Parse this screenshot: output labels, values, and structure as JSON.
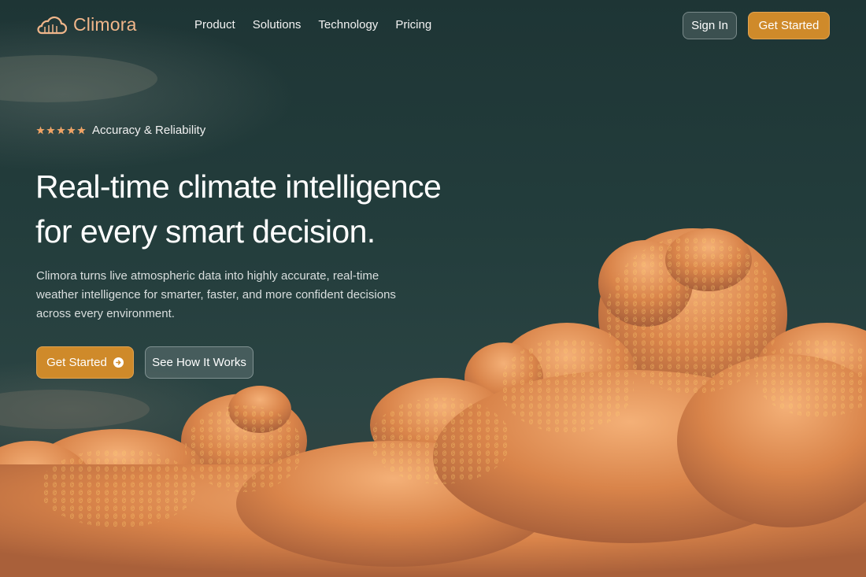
{
  "brand": {
    "name": "Climora",
    "logo_icon": "cloud-icon"
  },
  "nav": {
    "links": [
      "Product",
      "Solutions",
      "Technology",
      "Pricing"
    ],
    "sign_in": "Sign In",
    "get_started": "Get Started"
  },
  "hero": {
    "rating": {
      "stars": 5,
      "label": "Accuracy & Reliability"
    },
    "headline": [
      "Real-time climate intelligence",
      "for every smart decision."
    ],
    "description": "Climora turns live atmospheric data into highly accurate, real-time weather intelligence for smarter, faster, and more confident decisions across every environment.",
    "primary_cta": "Get Started",
    "primary_cta_icon": "arrow-right-circle-icon",
    "secondary_cta": "See How It Works"
  },
  "colors": {
    "accent": "#cf8a2a",
    "brand_text": "#f0b68a",
    "sky": "#223a3a",
    "cloud": "#e08a4a"
  }
}
